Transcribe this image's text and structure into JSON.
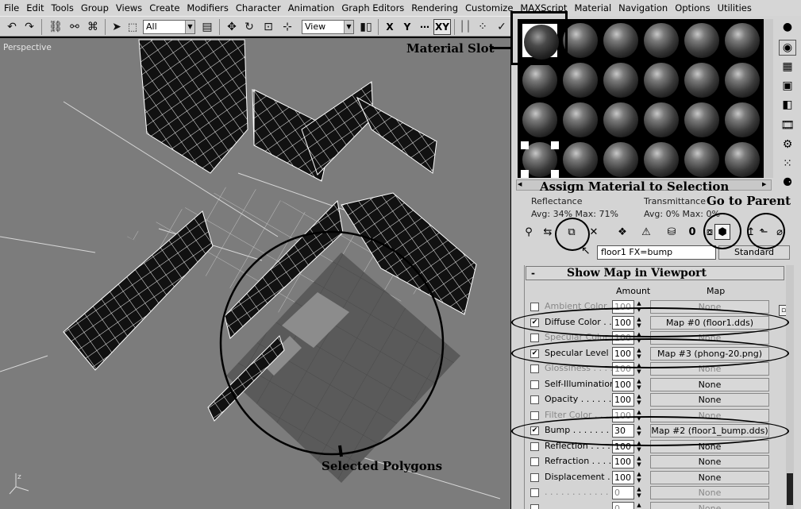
{
  "menu": [
    "File",
    "Edit",
    "Tools",
    "Group",
    "Views",
    "Create",
    "Modifiers",
    "Character",
    "Animation",
    "Graph Editors",
    "Rendering",
    "Customize",
    "MAXScript",
    "Material",
    "Navigation",
    "Options",
    "Utilities"
  ],
  "toolbar": {
    "selection_filter": "All",
    "ref_coord": "View",
    "axis_x": "X",
    "axis_y": "Y",
    "axis_xy": "XY"
  },
  "viewport": {
    "label": "Perspective",
    "axis_z": "z"
  },
  "material": {
    "reflectance_label": "Reflectance",
    "reflectance_avg": "Avg:  34%  Max:  71%",
    "transmittance_label": "Transmittance",
    "transmittance_avg": "Avg:    0%  Max:    0%",
    "name": "floor1 FX=bump",
    "type": "Standard"
  },
  "rollout": {
    "title": "Show Map in Viewport",
    "col_amount": "Amount",
    "col_map": "Map",
    "rows": [
      {
        "name": "Ambient Color . . .",
        "checked": false,
        "amount": "100",
        "map": "None",
        "dim": true
      },
      {
        "name": "Diffuse Color . . . .",
        "checked": true,
        "amount": "100",
        "map": "Map #0 (floor1.dds)"
      },
      {
        "name": "Specular Color . .",
        "checked": false,
        "amount": "100",
        "map": "None",
        "dim": true
      },
      {
        "name": "Specular Level  .",
        "checked": true,
        "amount": "100",
        "map": "Map #3 (phong-20.png)"
      },
      {
        "name": "Glossiness  . . . . .",
        "checked": false,
        "amount": "100",
        "map": "None",
        "dim": true
      },
      {
        "name": "Self-Illumination .",
        "checked": false,
        "amount": "100",
        "map": "None"
      },
      {
        "name": "Opacity  . . . . . . .",
        "checked": false,
        "amount": "100",
        "map": "None"
      },
      {
        "name": "Filter Color  . . . .",
        "checked": false,
        "amount": "100",
        "map": "None",
        "dim": true
      },
      {
        "name": "Bump  . . . . . . . .",
        "checked": true,
        "amount": "30",
        "map": "Map #2 (floor1_bump.dds)"
      },
      {
        "name": "Reflection  . . . . .",
        "checked": false,
        "amount": "100",
        "map": "None"
      },
      {
        "name": "Refraction  . . . . .",
        "checked": false,
        "amount": "100",
        "map": "None"
      },
      {
        "name": "Displacement  . .",
        "checked": false,
        "amount": "100",
        "map": "None"
      },
      {
        "name": ". . . . . . . . . . . . .",
        "checked": false,
        "amount": "0",
        "map": "None",
        "dim": true
      },
      {
        "name": ". . . . . . . . . . . . .",
        "checked": false,
        "amount": "0",
        "map": "None",
        "dim": true
      }
    ]
  },
  "annotations": {
    "material_slot": "Material Slot",
    "assign_material": "Assign Material to Selection",
    "go_to_parent": "Go to Parent",
    "show_map": "Show Map in Viewport",
    "selected_polygons": "Selected Polygons"
  }
}
